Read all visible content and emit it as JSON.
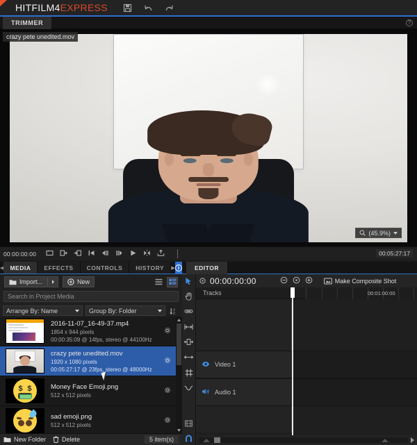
{
  "titlebar": {
    "brand_white": "HITFILM4",
    "brand_red": "EXPRESS",
    "icons": [
      "save-icon",
      "undo-icon",
      "redo-icon"
    ],
    "accent_blue": "#2f6fd0",
    "accent_red": "#d94a2b"
  },
  "trimmer": {
    "tab_label": "TRIMMER",
    "clip_badge": "crazy pete unedited.mov",
    "zoom_level": "(45.9%)",
    "help_label": "?"
  },
  "transport": {
    "current_timecode": "00:00:00:00",
    "duration_timecode": "00:05:27:17",
    "buttons": [
      "loop-icon",
      "export-out-icon",
      "insert-icon",
      "go-to-start-icon",
      "step-back-icon",
      "step-forward-icon",
      "play-icon",
      "markers-icon",
      "export-frame-icon"
    ]
  },
  "lower_tabs": {
    "prev_arrow": "◀",
    "items": [
      {
        "label": "MEDIA",
        "active": true
      },
      {
        "label": "EFFECTS",
        "active": false
      },
      {
        "label": "CONTROLS",
        "active": false
      },
      {
        "label": "HISTORY",
        "active": false
      }
    ],
    "more_arrow": "▶",
    "info_label": "i"
  },
  "media": {
    "import_label": "Import...",
    "new_label": "New",
    "search_placeholder": "Search in Project Media",
    "arrange_by": "Arrange By: Name",
    "group_by": "Group By: Folder",
    "view_list_icon": "list-view-icon",
    "view_detail_icon": "detail-view-icon",
    "sort_icon": "sort-az-icon",
    "items": [
      {
        "name": "2016-11-07_16-49-37.mp4",
        "dimensions": "1854 x 944 pixels",
        "details": "00:00:35:09 @ 14fps, stereo @ 44100Hz",
        "thumb": "screenshot",
        "selected": false
      },
      {
        "name": "crazy pete unedited.mov",
        "dimensions": "1920 x 1080 pixels",
        "details": "00:05:27:17 @ 23fps, stereo @ 48000Hz",
        "thumb": "person",
        "selected": true
      },
      {
        "name": "Money Face Emoji.png",
        "dimensions": "512 x 512 pixels",
        "details": "",
        "thumb": "money-emoji",
        "selected": false
      },
      {
        "name": "sad emoji.png",
        "dimensions": "512 x 512 pixels",
        "details": "",
        "thumb": "sad-emoji",
        "selected": false
      }
    ],
    "footer": {
      "new_folder_label": "New Folder",
      "delete_label": "Delete",
      "item_count": "5 item(s)"
    }
  },
  "editor": {
    "tab_label": "EDITOR",
    "timecode": "00:00:00:00",
    "make_composite_shot": "Make Composite Shot",
    "tracks_label": "Tracks",
    "ruler_marker": "00:01:00:00",
    "tools": [
      "pointer-tool-icon",
      "hand-tool-icon",
      "slip-tool-icon",
      "slide-tool-icon",
      "ripple-tool-icon",
      "stretch-tool-icon",
      "razor-tool-icon",
      "curve-tool-icon"
    ],
    "header_icons": [
      "zoom-out-icon",
      "zoom-fit-icon",
      "zoom-in-icon"
    ],
    "tracks": [
      {
        "name": "Video 1",
        "icon": "eye-icon"
      },
      {
        "name": "Audio 1",
        "icon": "speaker-icon"
      }
    ]
  }
}
